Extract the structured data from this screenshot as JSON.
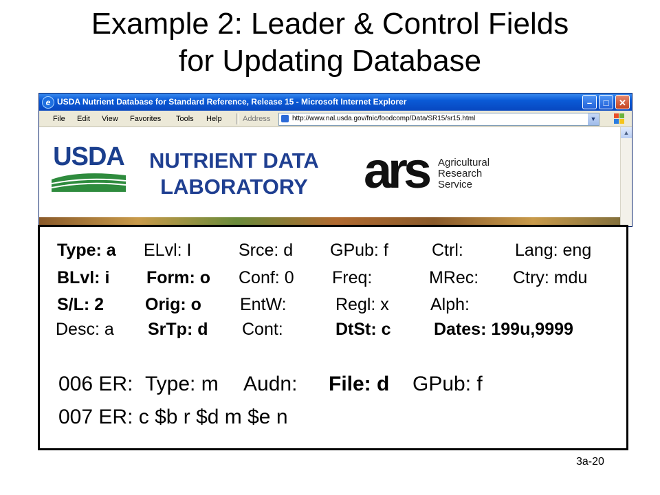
{
  "slide": {
    "title_line1": "Example 2: Leader & Control Fields",
    "title_line2": "for Updating Database",
    "page_number": "3a-20"
  },
  "browser": {
    "window_title": "USDA Nutrient Database for Standard Reference, Release 15 - Microsoft Internet Explorer",
    "menu": [
      "File",
      "Edit",
      "View",
      "Favorites",
      "Tools",
      "Help"
    ],
    "address_label": "Address",
    "url": "http://www.nal.usda.gov/fnic/foodcomp/Data/SR15/sr15.html",
    "page": {
      "usda_logo_text": "USDA",
      "lab_line1": "NUTRIENT DATA",
      "lab_line2": "LABORATORY",
      "ars_logo_text": "ars",
      "ars_line1": "Agricultural",
      "ars_line2": "Research",
      "ars_line3": "Service"
    }
  },
  "leader": {
    "row1": [
      "Type: a",
      "ELvl:   I",
      "Srce: d",
      "GPub: f",
      "Ctrl:",
      "Lang: eng"
    ],
    "row2": [
      "BLvl:  i",
      "Form: o",
      "Conf: 0",
      "Freq:",
      "MRec:",
      "Ctry: mdu"
    ],
    "row3": [
      "S/L:    2",
      "Orig:   o",
      "EntW:",
      "Regl: x",
      "Alph:"
    ],
    "row4": [
      "Desc:  a",
      "SrTp:  d",
      "Cont:",
      "DtSt: c",
      "Dates:",
      "199u,9999"
    ]
  },
  "control": {
    "f006_tag": "006 ER:",
    "f006_type": "Type: m",
    "f006_audn": "Audn:",
    "f006_file": "File: d",
    "f006_gpub": "GPub: f",
    "f007": "007 ER:  c $b r $d m $e n"
  },
  "colors": {
    "titlebar_blue": "#0a5ad6",
    "usda_blue": "#1b3f8e",
    "usda_green": "#2e8b3d"
  }
}
